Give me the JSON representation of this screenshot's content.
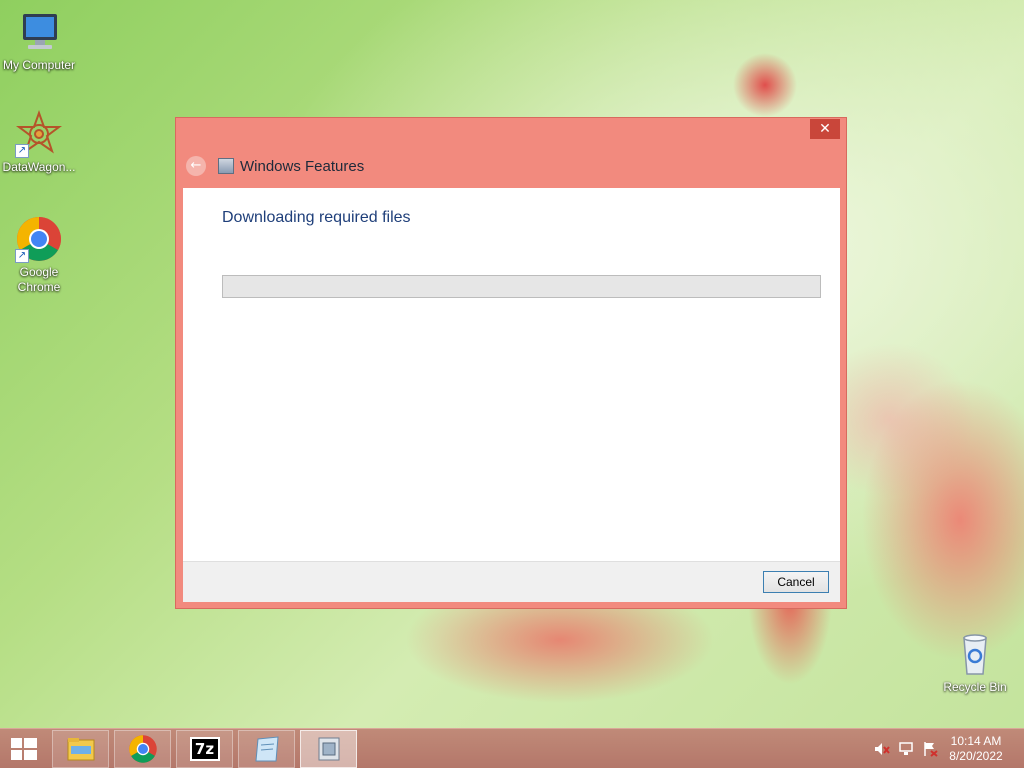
{
  "desktop": {
    "icons": [
      {
        "label": "My Computer",
        "icon": "computer-icon"
      },
      {
        "label": "DataWagon...",
        "icon": "datawagon-icon"
      },
      {
        "label": "Google Chrome",
        "icon": "chrome-icon"
      },
      {
        "label": "Recycle Bin",
        "icon": "recycle-bin-icon"
      }
    ]
  },
  "dialog": {
    "title": "Windows Features",
    "close_glyph": "✕",
    "back_glyph": "←",
    "heading": "Downloading required files",
    "progress_percent": 0,
    "cancel_label": "Cancel"
  },
  "taskbar": {
    "apps": [
      {
        "name": "File Explorer",
        "icon": "file-explorer-icon"
      },
      {
        "name": "Google Chrome",
        "icon": "chrome-icon"
      },
      {
        "name": "7-Zip",
        "icon": "7zip-icon",
        "text": "7z"
      },
      {
        "name": "Notepad",
        "icon": "notepad-icon"
      },
      {
        "name": "Windows Features",
        "icon": "windows-features-icon",
        "active": true
      }
    ],
    "tray": [
      "volume-muted-icon",
      "network-icon",
      "action-center-icon"
    ],
    "time": "10:14 AM",
    "date": "8/20/2022"
  },
  "colors": {
    "window_frame": "#f28a7e",
    "close_button": "#c9463a",
    "heading_text": "#1f3f7a",
    "taskbar": "#b4776a"
  }
}
